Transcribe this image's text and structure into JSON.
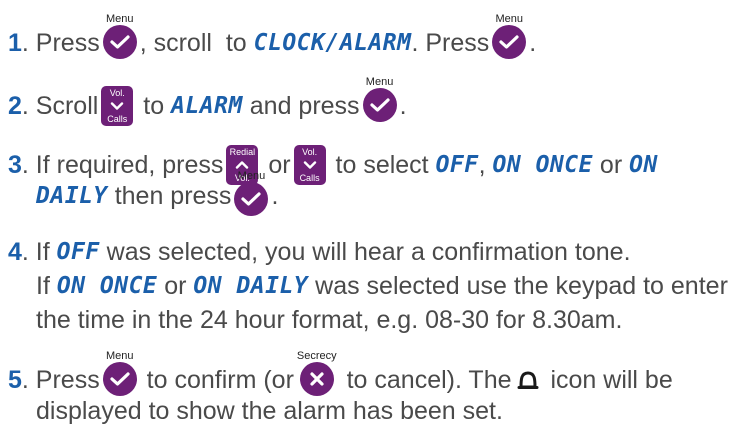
{
  "steps": [
    {
      "number": "1",
      "t1": ". Press",
      "key1_caption": "Menu",
      "t2": ", scroll  to ",
      "lcd1": "CLOCK/ALARM",
      "t3": ". Press",
      "key2_caption": "Menu",
      "t4": "."
    },
    {
      "number": "2",
      "t1": ". Scroll",
      "key1_top": "Vol.",
      "key1_bottom": "Calls",
      "t2": " to ",
      "lcd1": "ALARM",
      "t3": " and press",
      "key2_caption": "Menu",
      "t4": "."
    },
    {
      "number": "3",
      "t1": ". If required, press",
      "key1_top": "Redial",
      "key1_bottom": "Vol.",
      "t2": " or",
      "key2_top": "Vol.",
      "key2_bottom": "Calls",
      "t3": " to select ",
      "lcd1": "OFF",
      "t4": ", ",
      "lcd2": "ON ONCE",
      "t5": " or ",
      "lcd3": "ON",
      "lcd4": "DAILY",
      "t6": " then press",
      "key3_caption": "Menu",
      "t7": "."
    },
    {
      "number": "4",
      "t1": ". If ",
      "lcd1": "OFF",
      "t2": " was selected, you will hear a confirmation tone.",
      "t3": "If ",
      "lcd2": "ON ONCE",
      "t4": " or ",
      "lcd3": "ON DAILY",
      "t5": " was selected use the keypad to enter",
      "t6": "the time in the 24 hour format, e.g. 08-30 for 8.30am."
    },
    {
      "number": "5",
      "t1": ". Press",
      "key1_caption": "Menu",
      "t2": " to confirm (or",
      "key2_caption": "Secrecy",
      "t3": " to cancel). The",
      "icon": "bell-icon",
      "t4": " icon will be",
      "t5": "displayed to show the alarm has been set."
    }
  ],
  "colors": {
    "accent": "#1b5faa",
    "key": "#6d2077",
    "text": "#4a4a4a"
  }
}
